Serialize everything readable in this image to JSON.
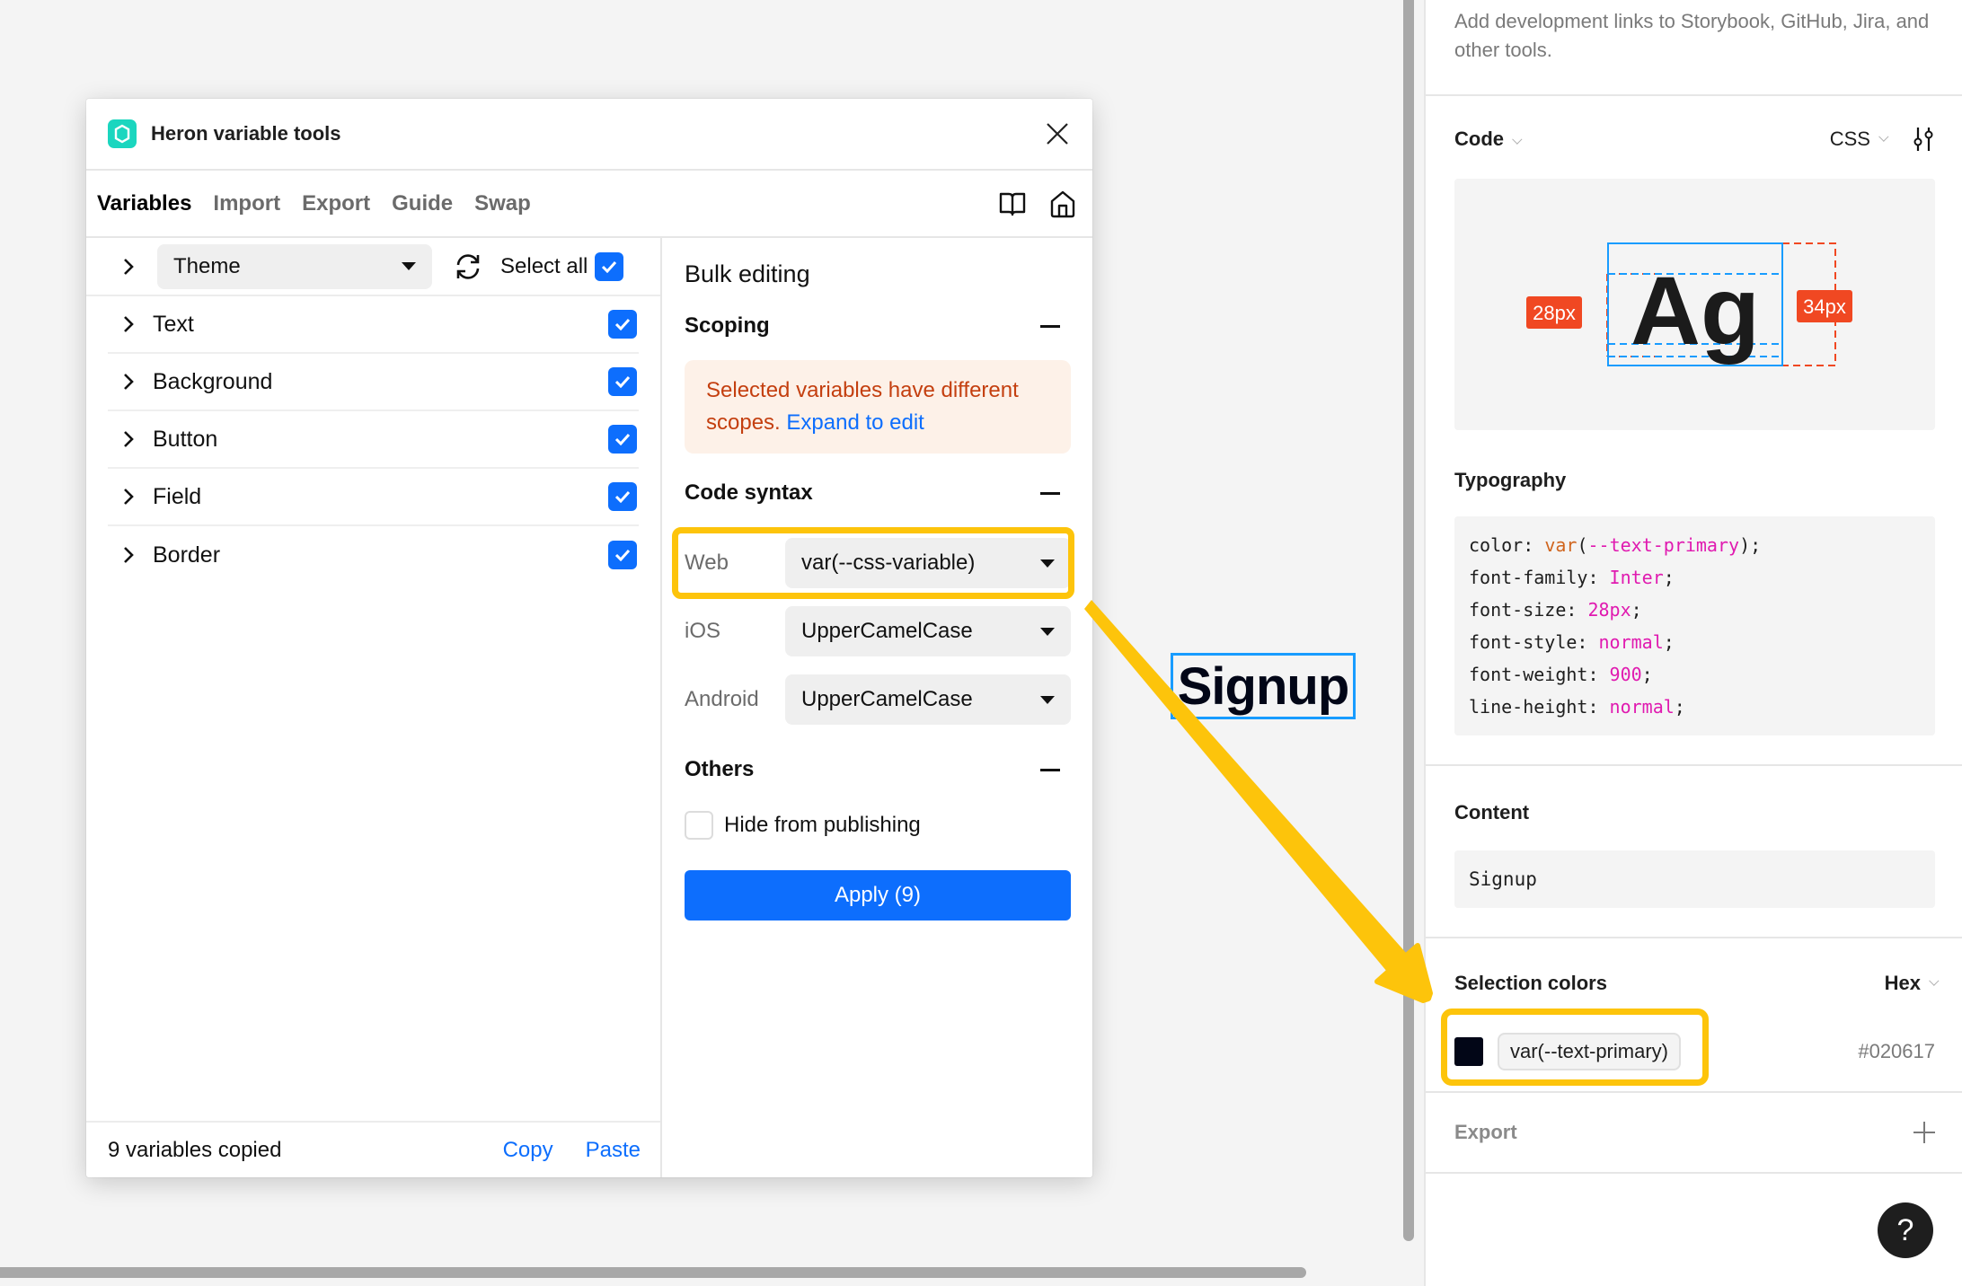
{
  "plugin": {
    "title": "Heron variable tools",
    "logo_icon": "heron-logo-icon",
    "close_icon": "close-icon",
    "tabs": [
      {
        "label": "Variables",
        "active": true
      },
      {
        "label": "Import",
        "active": false
      },
      {
        "label": "Export",
        "active": false
      },
      {
        "label": "Guide",
        "active": false
      },
      {
        "label": "Swap",
        "active": false
      }
    ],
    "toolbar_icons": [
      "book-icon",
      "home-icon"
    ],
    "collection_select": {
      "value": "Theme"
    },
    "refresh_icon": "refresh-icon",
    "select_all": {
      "label": "Select all",
      "checked": true
    },
    "groups": [
      {
        "label": "Text",
        "checked": true
      },
      {
        "label": "Background",
        "checked": true
      },
      {
        "label": "Button",
        "checked": true
      },
      {
        "label": "Field",
        "checked": true
      },
      {
        "label": "Border",
        "checked": true
      }
    ],
    "footer": {
      "status": "9 variables copied",
      "copy_label": "Copy",
      "paste_label": "Paste"
    },
    "bulk": {
      "title": "Bulk editing",
      "scoping": {
        "title": "Scoping",
        "warning": "Selected variables have different scopes.",
        "warning_link": "Expand to edit"
      },
      "code_syntax": {
        "title": "Code syntax",
        "rows": [
          {
            "label": "Web",
            "value": "var(--css-variable)",
            "highlighted": true
          },
          {
            "label": "iOS",
            "value": "UpperCamelCase",
            "highlighted": false
          },
          {
            "label": "Android",
            "value": "UpperCamelCase",
            "highlighted": false
          }
        ]
      },
      "others": {
        "title": "Others",
        "hide_from_publishing": {
          "label": "Hide from publishing",
          "checked": false
        }
      },
      "apply_label": "Apply (9)"
    }
  },
  "canvas": {
    "selected_text": "Signup",
    "text_color": "#020617",
    "annotation_color": "#fdc40b"
  },
  "inspector": {
    "dev_links_desc": "Add development links to Storybook, GitHub, Jira, and other tools.",
    "code": {
      "title": "Code",
      "language": "CSS",
      "settings_icon": "sliders-icon",
      "preview": {
        "glyphs": "Ag",
        "font_size_label": "28px",
        "line_height_label": "34px"
      }
    },
    "typography": {
      "title": "Typography",
      "lines": [
        {
          "prop": "color",
          "fn": "var",
          "value": "--text-primary",
          "suffix": ")"
        },
        {
          "prop": "font-family",
          "value": "Inter"
        },
        {
          "prop": "font-size",
          "value": "28px"
        },
        {
          "prop": "font-style",
          "value": "normal"
        },
        {
          "prop": "font-weight",
          "value": "900"
        },
        {
          "prop": "line-height",
          "value": "normal"
        }
      ]
    },
    "content": {
      "title": "Content",
      "value": "Signup"
    },
    "selection_colors": {
      "title": "Selection colors",
      "format": "Hex",
      "items": [
        {
          "name": "var(--text-primary)",
          "hex": "#020617",
          "swatch": "#020617"
        }
      ]
    },
    "export": {
      "title": "Export"
    },
    "help_label": "?"
  }
}
